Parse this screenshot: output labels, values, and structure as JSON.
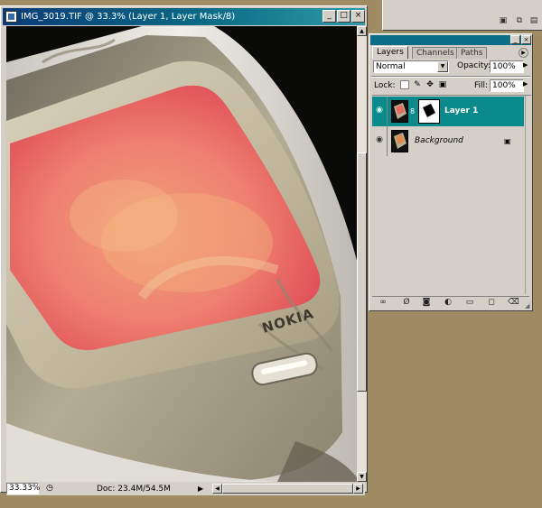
{
  "document": {
    "title": "IMG_3019.TIF @ 33.3% (Layer 1, Layer Mask/8)",
    "zoom": "33.33%",
    "doc_info": "Doc: 23.4M/54.5M",
    "canvas_brand": "NOKIA"
  },
  "window_controls": {
    "minimize": "_",
    "maximize": "□",
    "close": "×"
  },
  "layers_palette": {
    "tabs": [
      {
        "label": "Layers",
        "active": true
      },
      {
        "label": "Channels",
        "active": false
      },
      {
        "label": "Paths",
        "active": false
      }
    ],
    "blend_mode": "Normal",
    "opacity_label": "Opacity:",
    "opacity_value": "100%",
    "lock_label": "Lock:",
    "fill_label": "Fill:",
    "fill_value": "100%",
    "layers": [
      {
        "name": "Layer 1",
        "selected": true,
        "has_mask": true,
        "visible": true
      },
      {
        "name": "Background",
        "selected": false,
        "locked": true,
        "visible": true
      }
    ]
  },
  "icons": {
    "eye": "👁",
    "chain": "8",
    "lock": "🔒",
    "brush": "✎",
    "move": "✥",
    "link": "∞",
    "fx": "Ø",
    "mask": "◙",
    "adjust": "◐",
    "folder": "▭",
    "new": "◻",
    "trash": "🗑"
  },
  "colors": {
    "title_bar": "#0b6e84",
    "selected_layer": "#0a8a8a",
    "desktop": "#a08c64",
    "chrome": "#d4d0c8"
  }
}
